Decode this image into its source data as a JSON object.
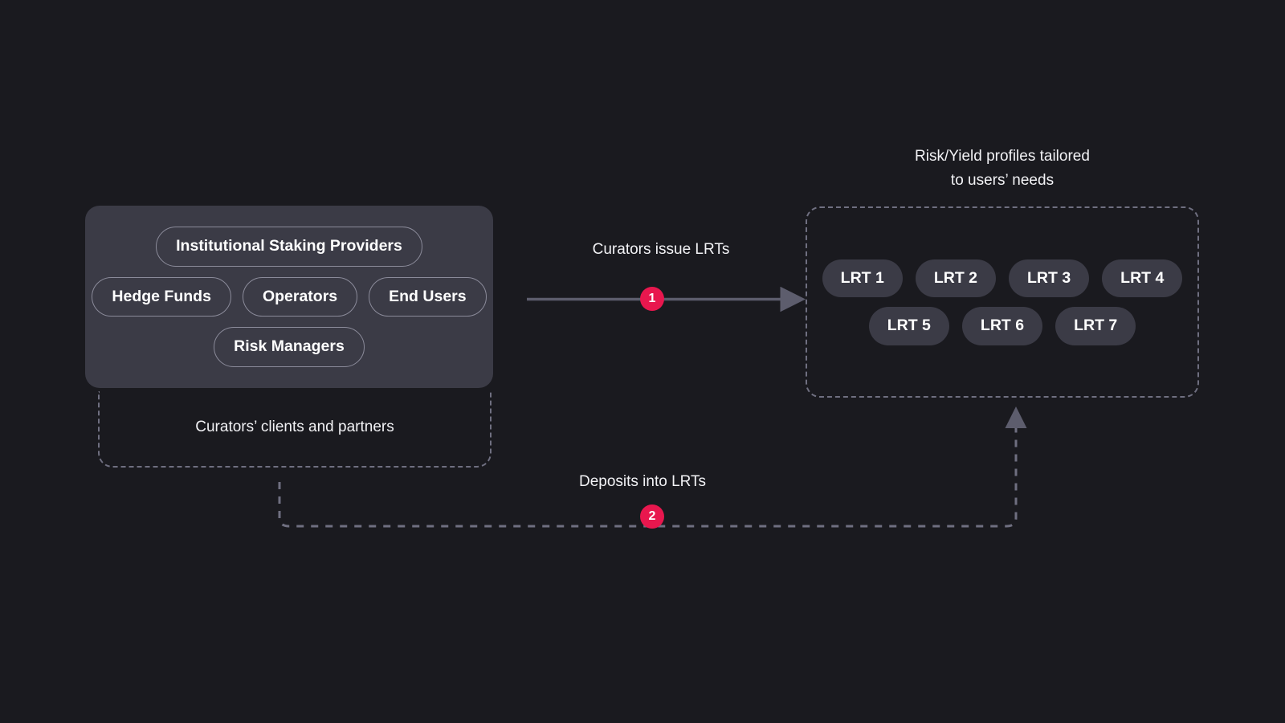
{
  "diagram": {
    "title_hidden": "",
    "background_color": "#1a1a1f",
    "accent_color": "#e8174e",
    "panel_color": "#3b3b46",
    "dashed_border_color": "#6f6f80"
  },
  "curators_panel": {
    "rows": [
      {
        "items": [
          {
            "label": "Institutional Staking Providers"
          }
        ]
      },
      {
        "items": [
          {
            "label": "Hedge Funds"
          },
          {
            "label": "Operators"
          },
          {
            "label": "End Users"
          }
        ]
      },
      {
        "items": [
          {
            "label": "Risk Managers"
          }
        ]
      }
    ]
  },
  "clients_group": {
    "caption": "Curators’ clients and partners"
  },
  "lrt_group": {
    "caption_line1": "Risk/Yield profiles tailored",
    "caption_line2": "to users’ needs",
    "rows": [
      {
        "items": [
          {
            "label": "LRT 1"
          },
          {
            "label": "LRT 2"
          },
          {
            "label": "LRT 3"
          },
          {
            "label": "LRT 4"
          }
        ]
      },
      {
        "items": [
          {
            "label": "LRT 5"
          },
          {
            "label": "LRT 6"
          },
          {
            "label": "LRT 7"
          }
        ]
      }
    ]
  },
  "flows": [
    {
      "step": "1",
      "label": "Curators issue LRTs",
      "style": "solid"
    },
    {
      "step": "2",
      "label": "Deposits into LRTs",
      "style": "dashed"
    }
  ]
}
